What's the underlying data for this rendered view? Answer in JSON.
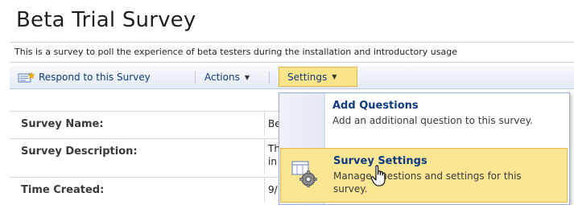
{
  "page": {
    "title": "Beta Trial Survey",
    "description": "This is a survey to poll the experience of beta testers during the installation and introductory usage"
  },
  "toolbar": {
    "respond_label": "Respond to this Survey",
    "actions_label": "Actions",
    "settings_label": "Settings"
  },
  "properties": [
    {
      "label": "Survey Name:",
      "value": "Be"
    },
    {
      "label": "Survey Description:",
      "value": "Th",
      "value2": "in"
    },
    {
      "label": "Time Created:",
      "value": "9/"
    }
  ],
  "settings_menu": {
    "items": [
      {
        "title": "Add Questions",
        "description": "Add an additional question to this survey."
      },
      {
        "title": "Survey Settings",
        "description": "Manage questions and settings for this survey."
      }
    ]
  },
  "icons": {
    "respond": "respond-survey-icon",
    "actions_caret": "chevron-down-icon",
    "settings_caret": "chevron-down-icon",
    "survey_settings": "survey-settings-gear-icon",
    "cursor": "hand-pointer-cursor-icon"
  },
  "colors": {
    "link_blue": "#0d3c85",
    "toolbar_gradient_top": "#f7f9fd",
    "toolbar_gradient_bottom": "#e3eaf5",
    "hover_yellow": "#fbe694",
    "hover_border": "#e9b94f"
  }
}
